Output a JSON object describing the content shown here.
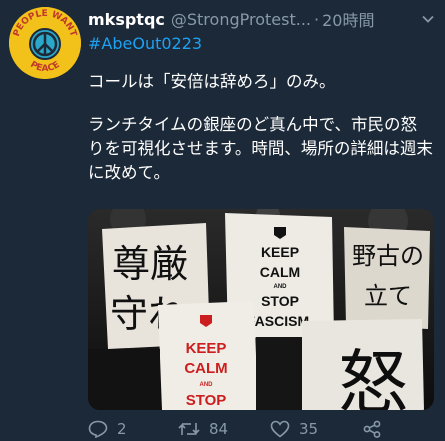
{
  "tweet": {
    "display_name": "mksptqc",
    "handle": "@StrongProtest...",
    "separator": "·",
    "timestamp": "20時間",
    "hashtag": "#AbeOut0223",
    "paragraphs": [
      "コールは「安倍は辞めろ」のみ。",
      "ランチタイムの銀座のど真ん中で、市民の怒りを可視化させます。時間、場所の詳細は週末に改めて。"
    ]
  },
  "avatar": {
    "text": "PEOPLE WANT PEACE",
    "icon": "peace-sign-icon"
  },
  "photo": {
    "signs": [
      "尊厳",
      "守れ",
      "KEEP",
      "CALM",
      "AND",
      "STOP",
      "FASCISM",
      "野古の",
      "立て",
      "KEEP",
      "CALM",
      "AND",
      "STOP",
      "怒"
    ]
  },
  "actions": {
    "replies": "2",
    "retweets": "84",
    "likes": "35"
  },
  "colors": {
    "background": "#1c2938",
    "link": "#1da1f2",
    "muted": "#8899a6",
    "avatar_yellow": "#f2c21a",
    "sign_red": "#cc1e1e"
  }
}
